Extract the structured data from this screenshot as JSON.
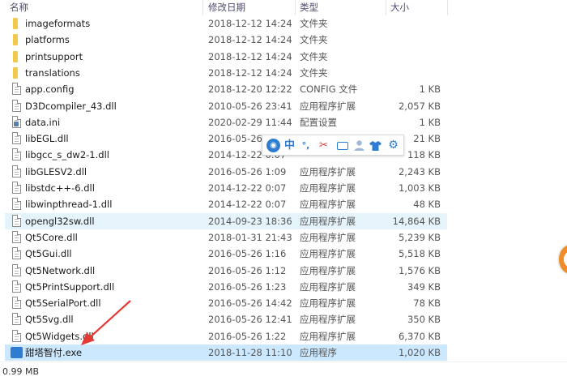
{
  "columns": {
    "name": "名称",
    "date": "修改日期",
    "type": "类型",
    "size": "大小"
  },
  "files": [
    {
      "name": "imageformats",
      "date": "2018-12-12 14:24",
      "type": "文件夹",
      "size": "",
      "icon": "folder-icon"
    },
    {
      "name": "platforms",
      "date": "2018-12-12 14:24",
      "type": "文件夹",
      "size": "",
      "icon": "folder-icon"
    },
    {
      "name": "printsupport",
      "date": "2018-12-12 14:24",
      "type": "文件夹",
      "size": "",
      "icon": "folder-icon"
    },
    {
      "name": "translations",
      "date": "2018-12-12 14:24",
      "type": "文件夹",
      "size": "",
      "icon": "folder-icon"
    },
    {
      "name": "app.config",
      "date": "2018-12-20 12:22",
      "type": "CONFIG 文件",
      "size": "1 KB",
      "icon": "file-icon"
    },
    {
      "name": "D3Dcompiler_43.dll",
      "date": "2010-05-26 23:41",
      "type": "应用程序扩展",
      "size": "2,057 KB",
      "icon": "dll-icon"
    },
    {
      "name": "data.ini",
      "date": "2020-02-29 11:44",
      "type": "配置设置",
      "size": "1 KB",
      "icon": "ini-icon"
    },
    {
      "name": "libEGL.dll",
      "date": "2016-05-26",
      "type": "",
      "size": "21 KB",
      "icon": "dll-icon"
    },
    {
      "name": "libgcc_s_dw2-1.dll",
      "date": "2014-12-22 0:07",
      "type": "",
      "size": "118 KB",
      "icon": "dll-icon"
    },
    {
      "name": "libGLESV2.dll",
      "date": "2016-05-26 1:09",
      "type": "应用程序扩展",
      "size": "2,243 KB",
      "icon": "dll-icon"
    },
    {
      "name": "libstdc++-6.dll",
      "date": "2014-12-22 0:07",
      "type": "应用程序扩展",
      "size": "1,003 KB",
      "icon": "dll-icon"
    },
    {
      "name": "libwinpthread-1.dll",
      "date": "2014-12-22 0:07",
      "type": "应用程序扩展",
      "size": "48 KB",
      "icon": "dll-icon"
    },
    {
      "name": "opengl32sw.dll",
      "date": "2014-09-23 18:36",
      "type": "应用程序扩展",
      "size": "14,864 KB",
      "icon": "dll-icon"
    },
    {
      "name": "Qt5Core.dll",
      "date": "2018-01-31 21:43",
      "type": "应用程序扩展",
      "size": "5,239 KB",
      "icon": "dll-icon"
    },
    {
      "name": "Qt5Gui.dll",
      "date": "2016-05-26 1:16",
      "type": "应用程序扩展",
      "size": "5,518 KB",
      "icon": "dll-icon"
    },
    {
      "name": "Qt5Network.dll",
      "date": "2016-05-26 1:12",
      "type": "应用程序扩展",
      "size": "1,576 KB",
      "icon": "dll-icon"
    },
    {
      "name": "Qt5PrintSupport.dll",
      "date": "2016-05-26 1:23",
      "type": "应用程序扩展",
      "size": "349 KB",
      "icon": "dll-icon"
    },
    {
      "name": "Qt5SerialPort.dll",
      "date": "2016-05-26 14:42",
      "type": "应用程序扩展",
      "size": "78 KB",
      "icon": "dll-icon"
    },
    {
      "name": "Qt5Svg.dll",
      "date": "2016-05-26 12:41",
      "type": "应用程序扩展",
      "size": "350 KB",
      "icon": "dll-icon"
    },
    {
      "name": "Qt5Widgets.dll",
      "date": "2016-05-26 1:22",
      "type": "应用程序扩展",
      "size": "6,370 KB",
      "icon": "dll-icon"
    },
    {
      "name": "甜塔智付.exe",
      "date": "2018-11-28 11:10",
      "type": "应用程序",
      "size": "1,020 KB",
      "icon": "exe-icon"
    }
  ],
  "hover_row": 12,
  "selected_row": 20,
  "status": {
    "selection_size": "0.99 MB"
  },
  "ime_toolbar": {
    "mode": "中"
  },
  "colors": {
    "hover": "#e5f3fb",
    "selected": "#cce8ff",
    "ime_accent": "#2f7dd1",
    "arrow": "#e53935"
  }
}
